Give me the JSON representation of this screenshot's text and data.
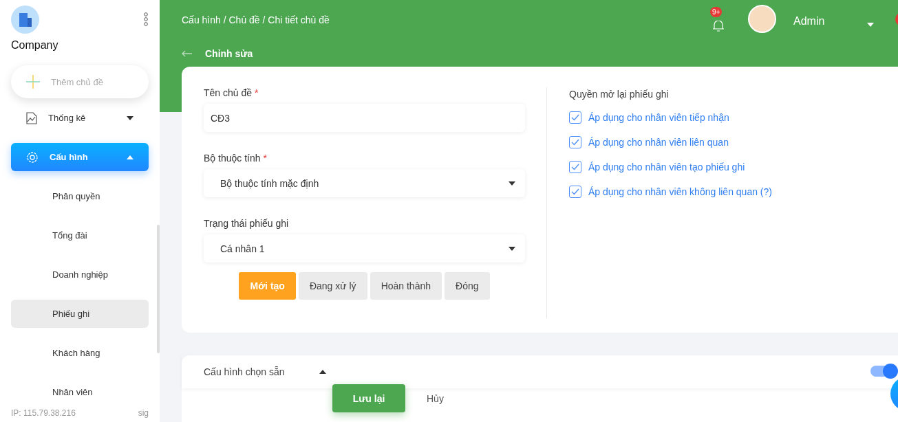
{
  "sidebar": {
    "company": "Company",
    "add_button": "Thêm chủ đề",
    "items": [
      {
        "label": "Thống kê",
        "kind": "chart",
        "expanded": false,
        "selected": false
      },
      {
        "label": "Cấu hình",
        "kind": "settings",
        "expanded": true,
        "selected": true,
        "children": [
          {
            "label": "Phân quyền",
            "selected": false
          },
          {
            "label": "Tổng đài",
            "selected": false
          },
          {
            "label": "Doanh nghiệp",
            "selected": false
          },
          {
            "label": "Phiếu ghi",
            "selected": true
          },
          {
            "label": "Khách hàng",
            "selected": false
          },
          {
            "label": "Nhân viên",
            "selected": false
          }
        ]
      }
    ],
    "footer_ip": "IP: 115.79.38.216",
    "footer_right": "sig"
  },
  "header": {
    "breadcrumb": "Cấu hình / Chủ đề / Chi tiết chủ đề",
    "notification_badge": "9+",
    "user_name": "Admin",
    "page_title": "Chỉnh sửa"
  },
  "form": {
    "required_mark": "*",
    "fields": [
      {
        "label": "Tên chủ đề",
        "required": true,
        "kind": "text",
        "value": "CĐ3"
      },
      {
        "label": "Bộ thuộc tính",
        "required": true,
        "kind": "select",
        "value": "Bộ thuộc tính mặc định"
      },
      {
        "label": "Trạng thái phiếu ghi",
        "required": false,
        "kind": "select",
        "value": "Cá nhân 1"
      }
    ],
    "status_tabs": [
      {
        "label": "Mới tạo",
        "selected": true
      },
      {
        "label": "Đang xử lý",
        "selected": false
      },
      {
        "label": "Hoàn thành",
        "selected": false
      },
      {
        "label": "Đóng",
        "selected": false
      }
    ],
    "permissions_title": "Quyền mở lại phiếu ghi",
    "permissions": [
      {
        "label": "Áp dụng cho nhân viên tiếp nhận",
        "checked": true
      },
      {
        "label": "Áp dụng cho nhân viên liên quan",
        "checked": true
      },
      {
        "label": "Áp dụng cho nhân viên tạo phiếu ghi",
        "checked": true
      },
      {
        "label": "Áp dụng cho nhân viên không liên quan (?)",
        "checked": true
      }
    ]
  },
  "preset": {
    "title": "Cấu hình chọn sẵn",
    "expanded": true,
    "toggle_on": true
  },
  "actions": {
    "save": "Lưu lại",
    "cancel": "Hủy"
  }
}
